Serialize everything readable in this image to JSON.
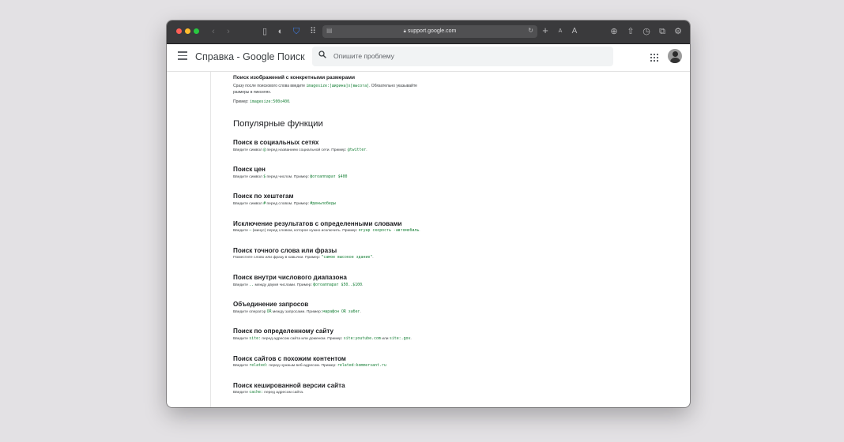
{
  "browser": {
    "url": "support.google.com",
    "text_size_small": "A",
    "text_size_large": "A"
  },
  "appbar": {
    "title": "Справка - Google Поиск",
    "search_placeholder": "Опишите проблему"
  },
  "top_section": {
    "heading": "Поиск изображений с конкретными размерами",
    "line1_a": "Сразу после поискового слова введите",
    "line1_code": "imagesize:[ширина]x[высота]",
    "line1_b": ". Обязательно указывайте",
    "line2": "размеры в пикселях.",
    "example_label": "Пример:",
    "example_code": "imagesize:500x400",
    "example_end": "."
  },
  "popular": {
    "title": "Популярные функции",
    "items": [
      {
        "heading": "Поиск в социальных сетях",
        "a": "Введите символ ",
        "c1": "@",
        "b": " перед названием социальной сети. Пример: ",
        "c2": "@twitter",
        "d": "."
      },
      {
        "heading": "Поиск цен",
        "a": "Введите символ ",
        "c1": "$",
        "b": " перед числом. Пример: ",
        "c2": "фотоаппарат $400",
        "d": ""
      },
      {
        "heading": "Поиск по хештегам",
        "a": "Введите символ ",
        "c1": "#",
        "b": " перед словом. Пример: ",
        "c2": "#деньпобеды",
        "d": ""
      },
      {
        "heading": "Исключение результатов с определенными словами",
        "a": "Введите ",
        "c1": "–",
        "b": " (минус) перед словом, которое нужно исключить. Пример: ",
        "c2": "ягуар скорость -автомобиль",
        "d": "."
      },
      {
        "heading": "Поиск точного слова или фразы",
        "a": "Поместите слово или фразу в кавычки. Пример: ",
        "c1": "",
        "b": "",
        "c2": "\"самое высокое здание\"",
        "d": "."
      },
      {
        "heading": "Поиск внутри числового диапазона",
        "a": "Введите ",
        "c1": "..",
        "b": " между двумя числами. Пример: ",
        "c2": "фотоаппарат $50..$100",
        "d": "."
      },
      {
        "heading": "Объединение запросов",
        "a": "Введите оператор ",
        "c1": "OR",
        "b": " между запросами. Пример: ",
        "c2": "марафон OR забег",
        "d": "."
      },
      {
        "heading": "Поиск по определенному сайту",
        "a": "Введите ",
        "c1": "site:",
        "b": " перед адресом сайта или доменом. Пример: ",
        "c2": "site:youtube.com",
        "d": " или ",
        "c3": "site:.gov",
        "e": "."
      },
      {
        "heading": "Поиск сайтов с похожим контентом",
        "a": "Введите ",
        "c1": "related:",
        "b": " перед нужным веб-адресом. Пример: ",
        "c2": "related:kommersant.ru",
        "d": ""
      },
      {
        "heading": "Поиск кешированной версии сайта",
        "a": "Введите ",
        "c1": "cache:",
        "b": " перед адресом сайта.",
        "c2": "",
        "d": ""
      }
    ]
  }
}
